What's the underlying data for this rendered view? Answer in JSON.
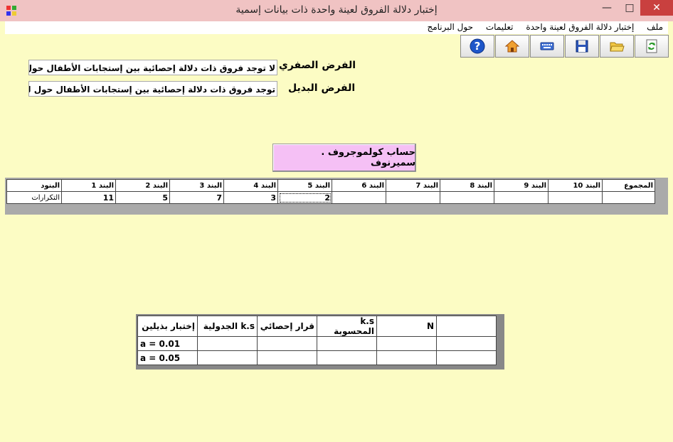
{
  "window": {
    "title": "إختبار دلالة الفروق لعينة واحدة ذات بيانات إسمية",
    "min_glyph": "—",
    "max_glyph": "□",
    "close_glyph": "✕"
  },
  "menu": {
    "items": [
      "ملف",
      "إختبار دلالة الفروق لعينة واحدة",
      "تعليمات",
      "حول البرنامج"
    ]
  },
  "toolbar": {
    "icons": [
      "help-icon",
      "home-icon",
      "keyboard-icon",
      "save-icon",
      "open-folder-icon",
      "refresh-icon"
    ],
    "help_glyph": "?"
  },
  "hypotheses": {
    "null_label": "الفرض الصفري",
    "null_text": "لا توجد فروق ذات دلالة إحصائية بين إستجابات الأطفال حول لونهم ا",
    "alt_label": "الفرض البديل",
    "alt_text": "توجد فروق ذات دلالة إحصائية بين إستجابات الأطفال حول لونهم المف"
  },
  "calc_button_label": "حساب كولموجروف . سميرنوف",
  "freq_table": {
    "row_header_label": "البنود",
    "row_label": "التكرارات",
    "columns": [
      "البند 1",
      "البند 2",
      "البند 3",
      "البند 4",
      "البند 5",
      "البند 6",
      "البند 7",
      "البند 8",
      "البند 9",
      "البند 10",
      "المجموع"
    ],
    "values": [
      "11",
      "5",
      "7",
      "3",
      "2",
      "",
      "",
      "",
      "",
      "",
      ""
    ]
  },
  "result_table": {
    "headers": [
      "إختبار بذيلين",
      "k.s الجدولية",
      "قرار إحصائي",
      "k.s المحسوبة",
      "N",
      ""
    ],
    "rows": [
      {
        "label": "a = 0.01",
        "cells": [
          "",
          "",
          "",
          "",
          ""
        ]
      },
      {
        "label": "a = 0.05",
        "cells": [
          "",
          "",
          "",
          "",
          ""
        ]
      }
    ]
  },
  "colors": {
    "background": "#fcfcc4",
    "titlebar": "#f0c3c3",
    "close_button": "#c9403f",
    "calc_button": "#f5c0f5"
  }
}
